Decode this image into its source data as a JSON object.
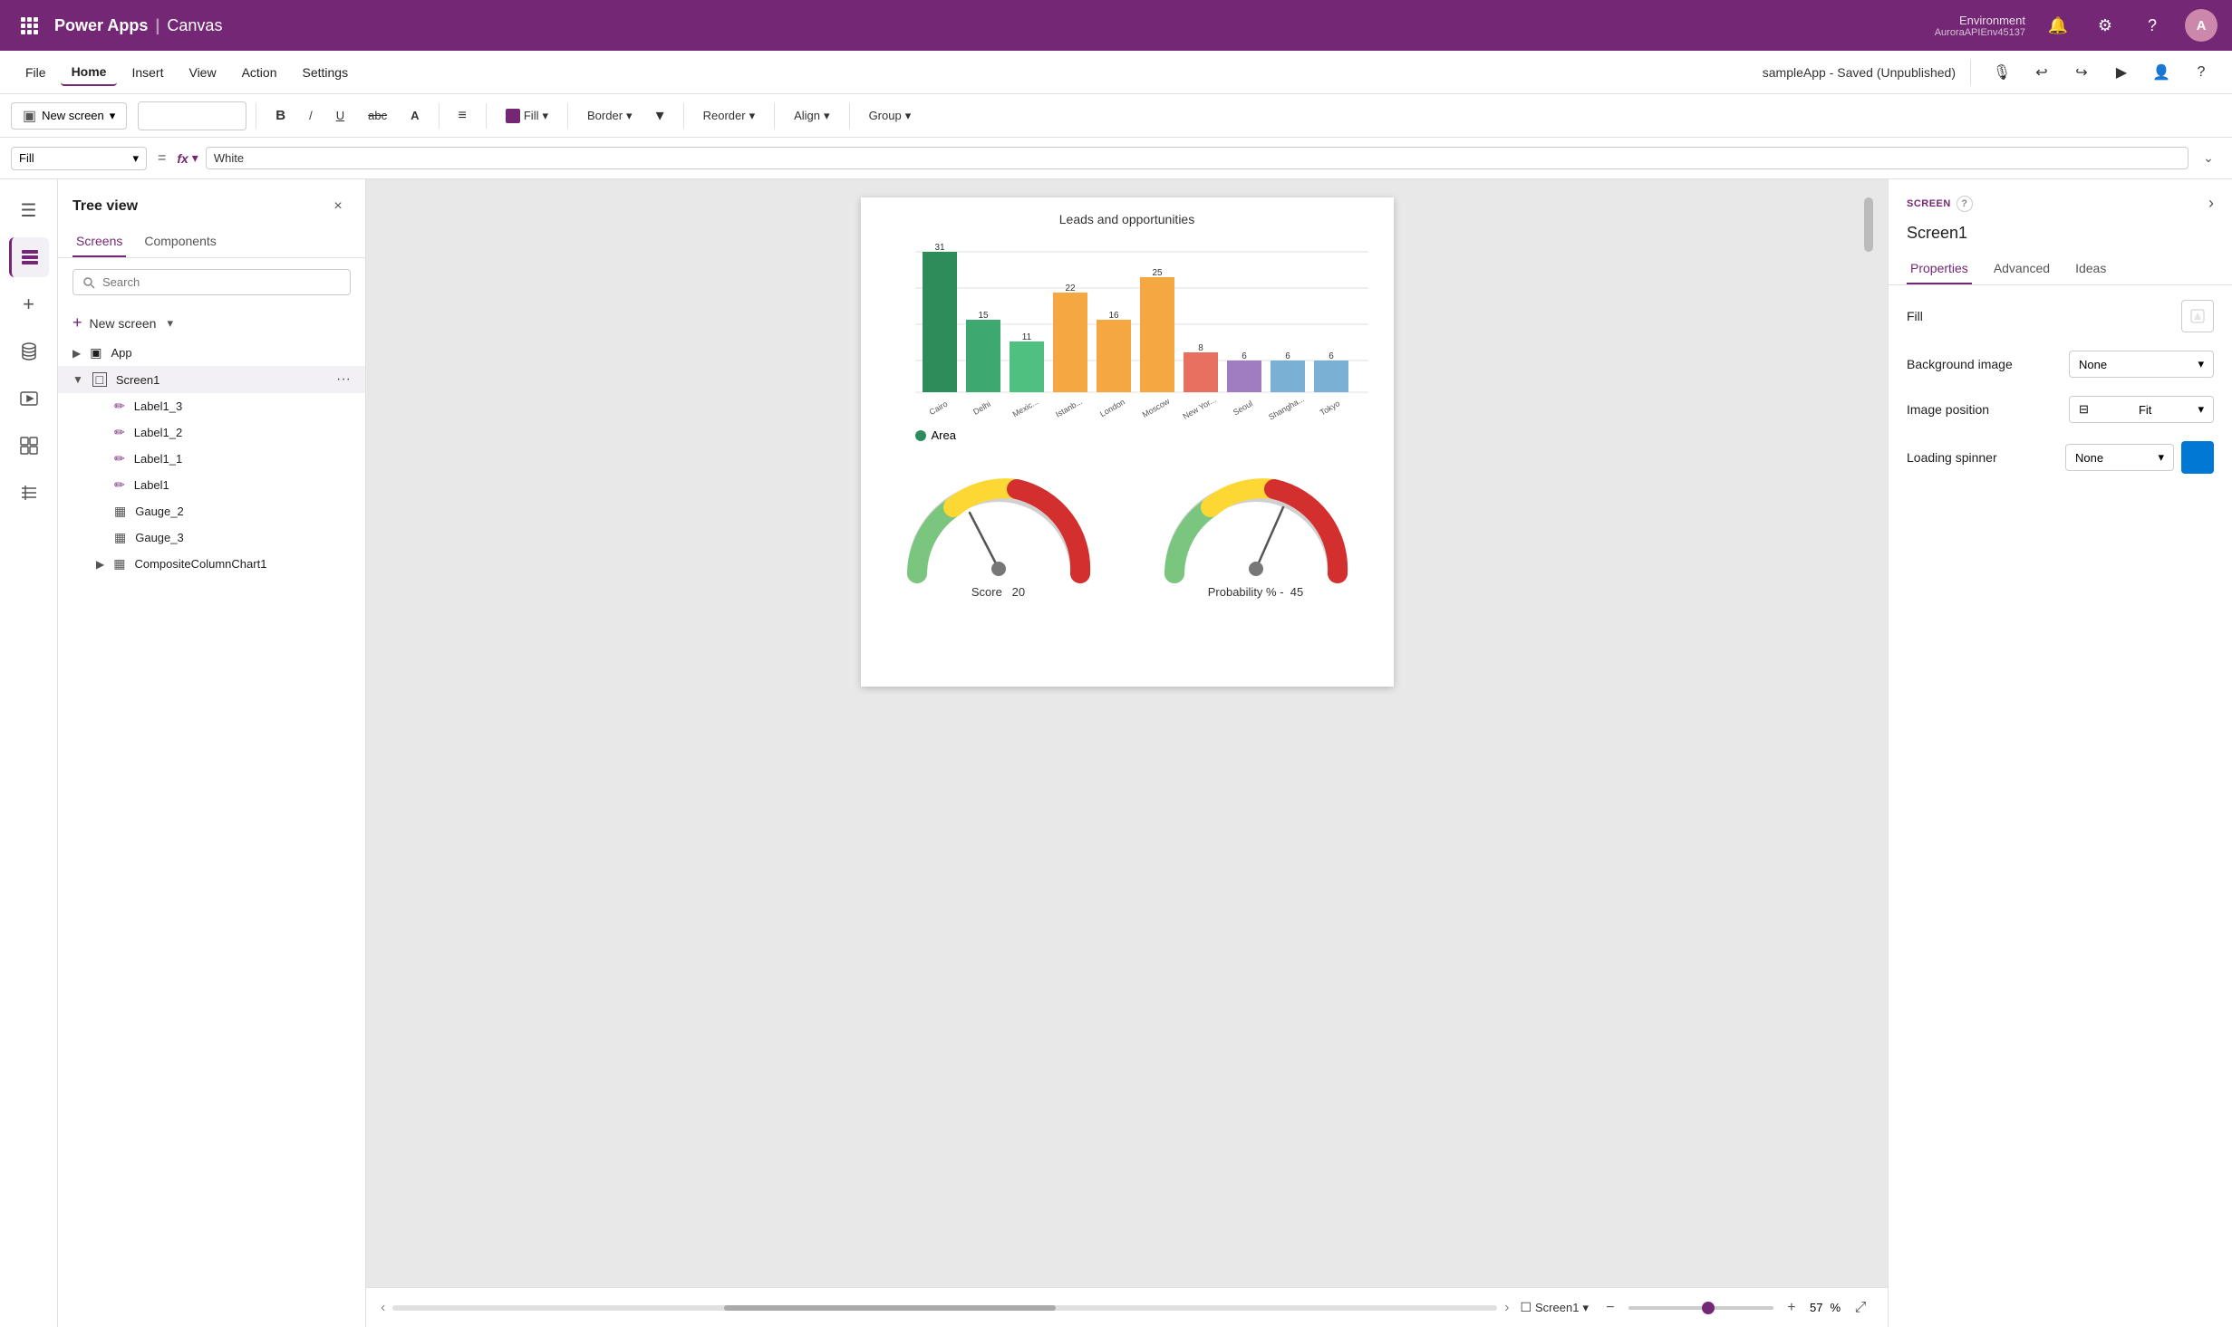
{
  "topNav": {
    "waffle_icon": "⊞",
    "app_name": "Power Apps",
    "separator": "|",
    "canvas": "Canvas",
    "environment_label": "Environment",
    "environment_id": "AuroraAPIEnv45137",
    "notification_icon": "🔔",
    "settings_icon": "⚙",
    "help_icon": "?",
    "avatar_label": "A"
  },
  "menuBar": {
    "items": [
      "File",
      "Home",
      "Insert",
      "View",
      "Action",
      "Settings"
    ],
    "active": "Home",
    "app_status": "sampleApp - Saved (Unpublished)",
    "icons": [
      "🎙",
      "↩",
      "↪",
      "▶",
      "👤",
      "?"
    ]
  },
  "toolbar": {
    "new_screen_label": "New screen",
    "bold_label": "B",
    "italic_label": "/",
    "underline_label": "U",
    "strikethrough_label": "abc",
    "font_color_label": "A",
    "align_label": "≡",
    "fill_label": "Fill",
    "border_label": "Border",
    "reorder_label": "Reorder",
    "align2_label": "Align",
    "group_label": "Group",
    "dropdown_icon": "▾"
  },
  "formulaBar": {
    "property": "Fill",
    "eq": "=",
    "fx_label": "fx",
    "formula_value": "White",
    "expand_icon": "⌄"
  },
  "treeView": {
    "title": "Tree view",
    "close_icon": "×",
    "tabs": [
      "Screens",
      "Components"
    ],
    "active_tab": "Screens",
    "search_placeholder": "Search",
    "new_screen_label": "New screen",
    "new_screen_icon": "+",
    "items": [
      {
        "id": "app",
        "label": "App",
        "indent": 0,
        "icon": "▣",
        "collapsed": false
      },
      {
        "id": "screen1",
        "label": "Screen1",
        "indent": 0,
        "icon": "□",
        "selected": true,
        "collapsed": false,
        "more_icon": "···"
      },
      {
        "id": "label1_3",
        "label": "Label1_3",
        "indent": 2,
        "icon": "✏"
      },
      {
        "id": "label1_2",
        "label": "Label1_2",
        "indent": 2,
        "icon": "✏"
      },
      {
        "id": "label1_1",
        "label": "Label1_1",
        "indent": 2,
        "icon": "✏"
      },
      {
        "id": "label1",
        "label": "Label1",
        "indent": 2,
        "icon": "✏"
      },
      {
        "id": "gauge_2",
        "label": "Gauge_2",
        "indent": 2,
        "icon": "▦"
      },
      {
        "id": "gauge_3",
        "label": "Gauge_3",
        "indent": 2,
        "icon": "▦"
      },
      {
        "id": "composite",
        "label": "CompositeColumnChart1",
        "indent": 2,
        "icon": "▦",
        "collapsed": true
      }
    ]
  },
  "canvas": {
    "chart_title": "Leads and opportunities",
    "chart_bars": [
      {
        "label": "Cairo",
        "value": 31,
        "color": "#2d8c5a"
      },
      {
        "label": "Delhi",
        "value": 15,
        "color": "#3da86f"
      },
      {
        "label": "Mexic...",
        "value": 11,
        "color": "#4fc080"
      },
      {
        "label": "Istanb...",
        "value": 22,
        "color": "#f5a742"
      },
      {
        "label": "London",
        "value": 16,
        "color": "#f5a742"
      },
      {
        "label": "Moscow",
        "value": 25,
        "color": "#f5a742"
      },
      {
        "label": "New Yor...",
        "value": 8,
        "color": "#e87060"
      },
      {
        "label": "Seoul",
        "value": 6,
        "color": "#a07cc0"
      },
      {
        "label": "Shangha...",
        "value": 6,
        "color": "#7ab0d4"
      },
      {
        "label": "Tokyo",
        "value": 6,
        "color": "#7ab0d4"
      }
    ],
    "legend_dot_color": "#2d8c5a",
    "legend_label": "Area",
    "gauge1_label": "Score",
    "gauge1_value": "20",
    "gauge2_label": "Probability % -",
    "gauge2_value": "45",
    "screen_name": "Screen1",
    "zoom_minus": "−",
    "zoom_plus": "+",
    "zoom_value": "57",
    "zoom_unit": "%",
    "fullscreen_icon": "⤢"
  },
  "propertiesPanel": {
    "section_title": "SCREEN",
    "help_icon": "?",
    "expand_icon": "›",
    "screen_name": "Screen1",
    "tabs": [
      "Properties",
      "Advanced",
      "Ideas"
    ],
    "active_tab": "Properties",
    "fill_label": "Fill",
    "fill_icon": "🎨",
    "background_image_label": "Background image",
    "background_image_value": "None",
    "image_position_label": "Image position",
    "image_position_value": "Fit",
    "image_position_icon": "⊟",
    "loading_spinner_label": "Loading spinner",
    "loading_spinner_value": "None",
    "loading_spinner_color": "#0078d4",
    "dropdown_arrow": "▾"
  }
}
